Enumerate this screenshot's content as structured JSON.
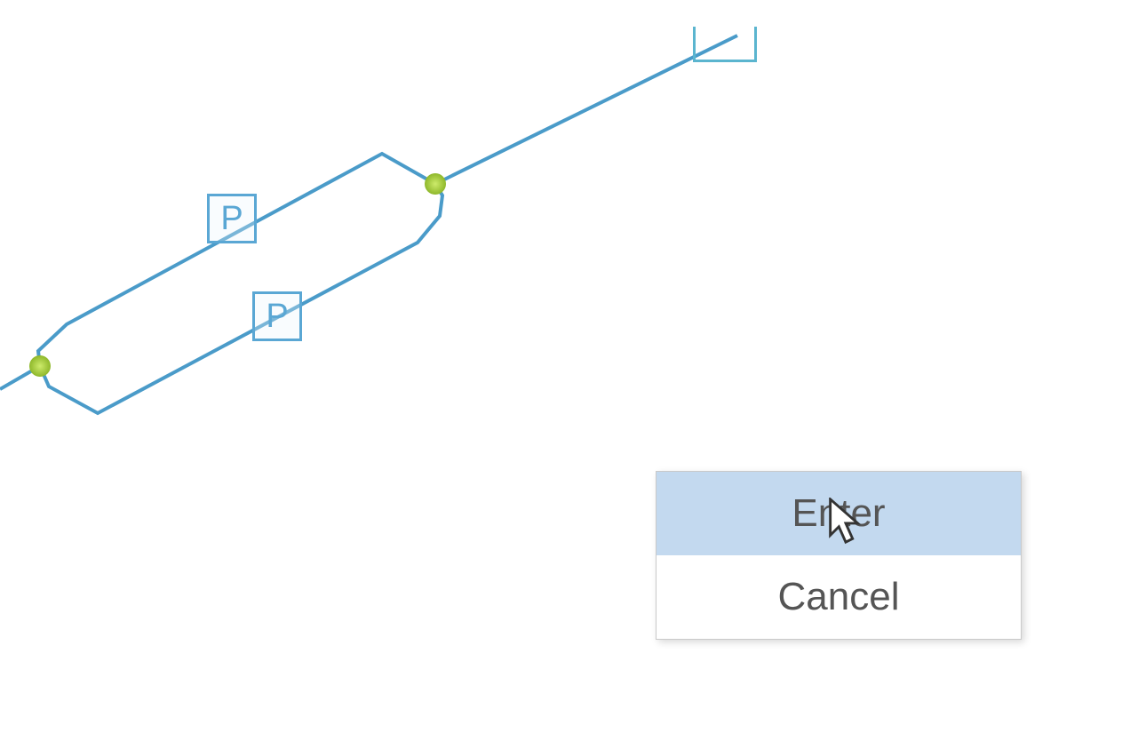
{
  "constraints": {
    "top_label": "P",
    "bottom_label": "P"
  },
  "context_menu": {
    "items": [
      {
        "label": "Enter",
        "hovered": true
      },
      {
        "label": "Cancel",
        "hovered": false
      }
    ]
  }
}
